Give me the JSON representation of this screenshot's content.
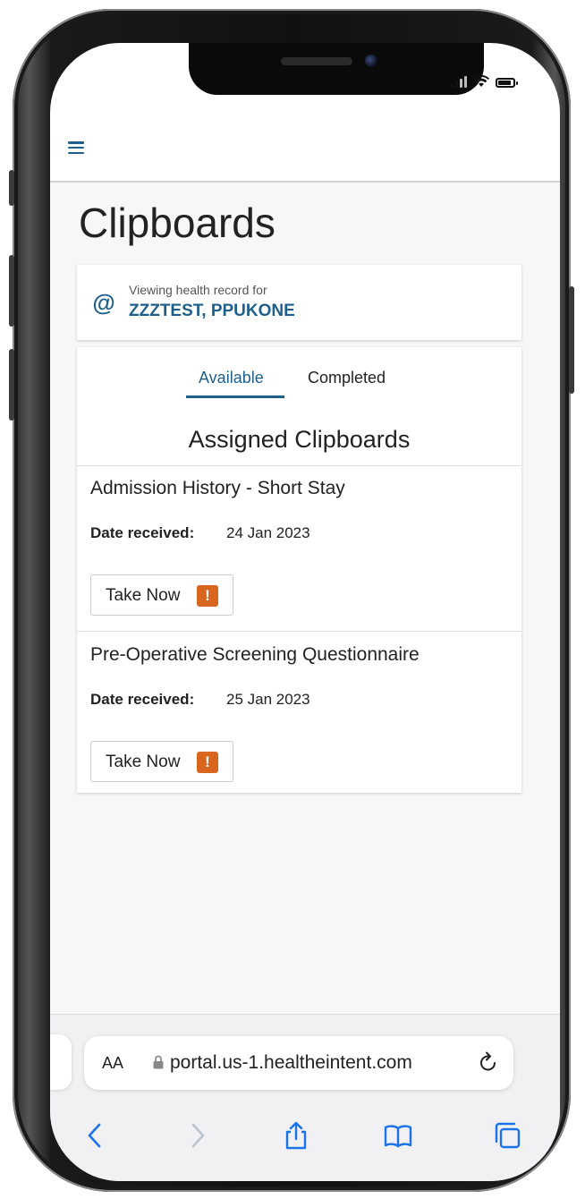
{
  "page": {
    "title": "Clipboards"
  },
  "record": {
    "label": "Viewing health record for",
    "patient_name": "ZZZTEST, PPUKONE"
  },
  "tabs": [
    {
      "label": "Available",
      "active": true
    },
    {
      "label": "Completed",
      "active": false
    }
  ],
  "section_title": "Assigned Clipboards",
  "clipboards": [
    {
      "title": "Admission History - Short Stay",
      "date_label": "Date received:",
      "date": "24 Jan 2023",
      "action_label": "Take Now",
      "alert_glyph": "!"
    },
    {
      "title": "Pre-Operative Screening Questionnaire",
      "date_label": "Date received:",
      "date": "25 Jan 2023",
      "action_label": "Take Now",
      "alert_glyph": "!"
    }
  ],
  "browser": {
    "text_size_label": "AA",
    "url": "portal.us-1.healtheintent.com"
  },
  "icons": {
    "menu": "hamburger-menu-icon",
    "record": "at-sign-icon",
    "alert": "exclamation-icon",
    "lock": "lock-icon",
    "reload": "reload-icon",
    "back": "chevron-left-icon",
    "forward": "chevron-right-icon",
    "share": "share-icon",
    "bookmarks": "book-icon",
    "tabs": "tabs-icon"
  },
  "colors": {
    "accent": "#1f5f8b",
    "alert": "#d9661f",
    "ios_blue": "#1a73e8"
  }
}
